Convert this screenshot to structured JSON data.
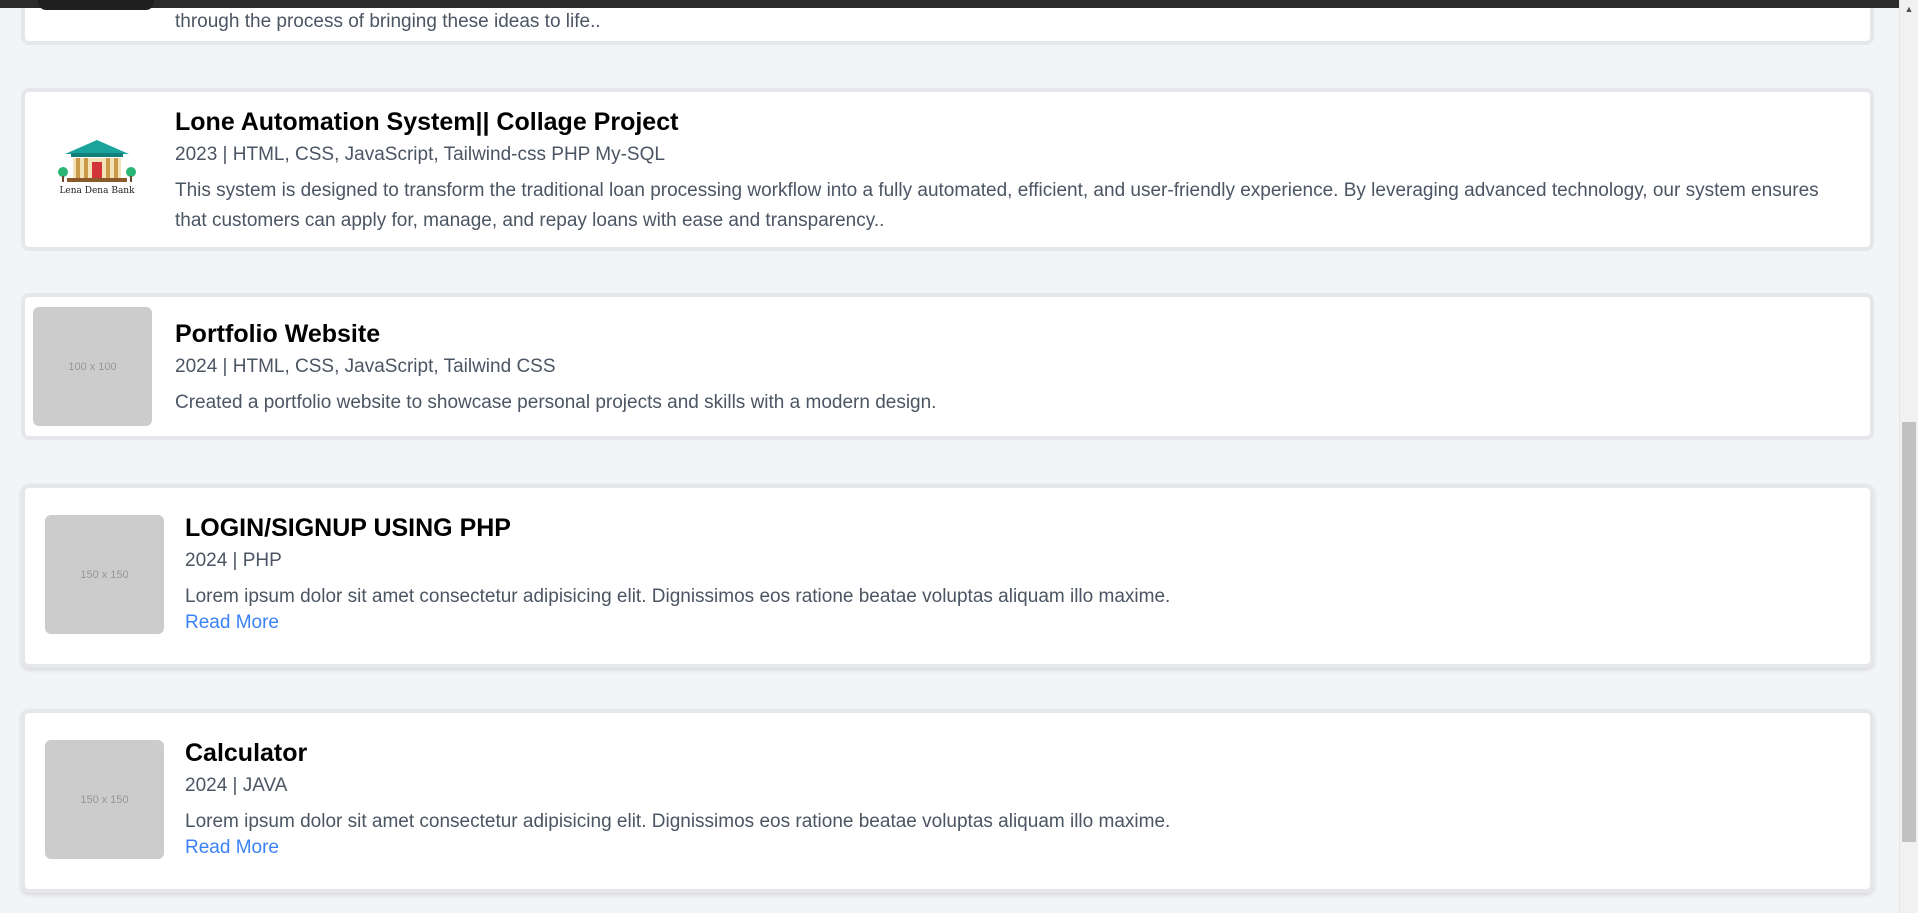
{
  "cards": [
    {
      "description": "through the process of bringing these ideas to life.."
    },
    {
      "title": "Lone Automation System|| Collage Project",
      "meta": "2023 | HTML, CSS, JavaScript, Tailwind-css PHP My-SQL",
      "description": "This system is designed to transform the traditional loan processing workflow into a fully automated, efficient, and user-friendly experience. By leveraging advanced technology, our system ensures that customers can apply for, manage, and repay loans with ease and transparency..",
      "logo_caption": "Lena Dena Bank"
    },
    {
      "title": "Portfolio Website",
      "meta": "2024 | HTML, CSS, JavaScript, Tailwind CSS",
      "description": "Created a portfolio website to showcase personal projects and skills with a modern design.",
      "thumb_label": "100 x 100"
    },
    {
      "title": "LOGIN/SIGNUP USING PHP",
      "meta": "2024 | PHP",
      "description": "Lorem ipsum dolor sit amet consectetur adipisicing elit. Dignissimos eos ratione beatae voluptas aliquam illo maxime.",
      "link": "Read More",
      "thumb_label": "150 x 150"
    },
    {
      "title": "Calculator",
      "meta": "2024 | JAVA",
      "description": "Lorem ipsum dolor sit amet consectetur adipisicing elit. Dignissimos eos ratione beatae voluptas aliquam illo maxime.",
      "link": "Read More",
      "thumb_label": "150 x 150"
    }
  ],
  "colors": {
    "accent": "#3b82f6",
    "muted_text": "#4b5563",
    "background": "#f3f4f6"
  },
  "icons": {
    "scroll_up": "caret-up-icon",
    "logo": "bank-building-icon"
  }
}
